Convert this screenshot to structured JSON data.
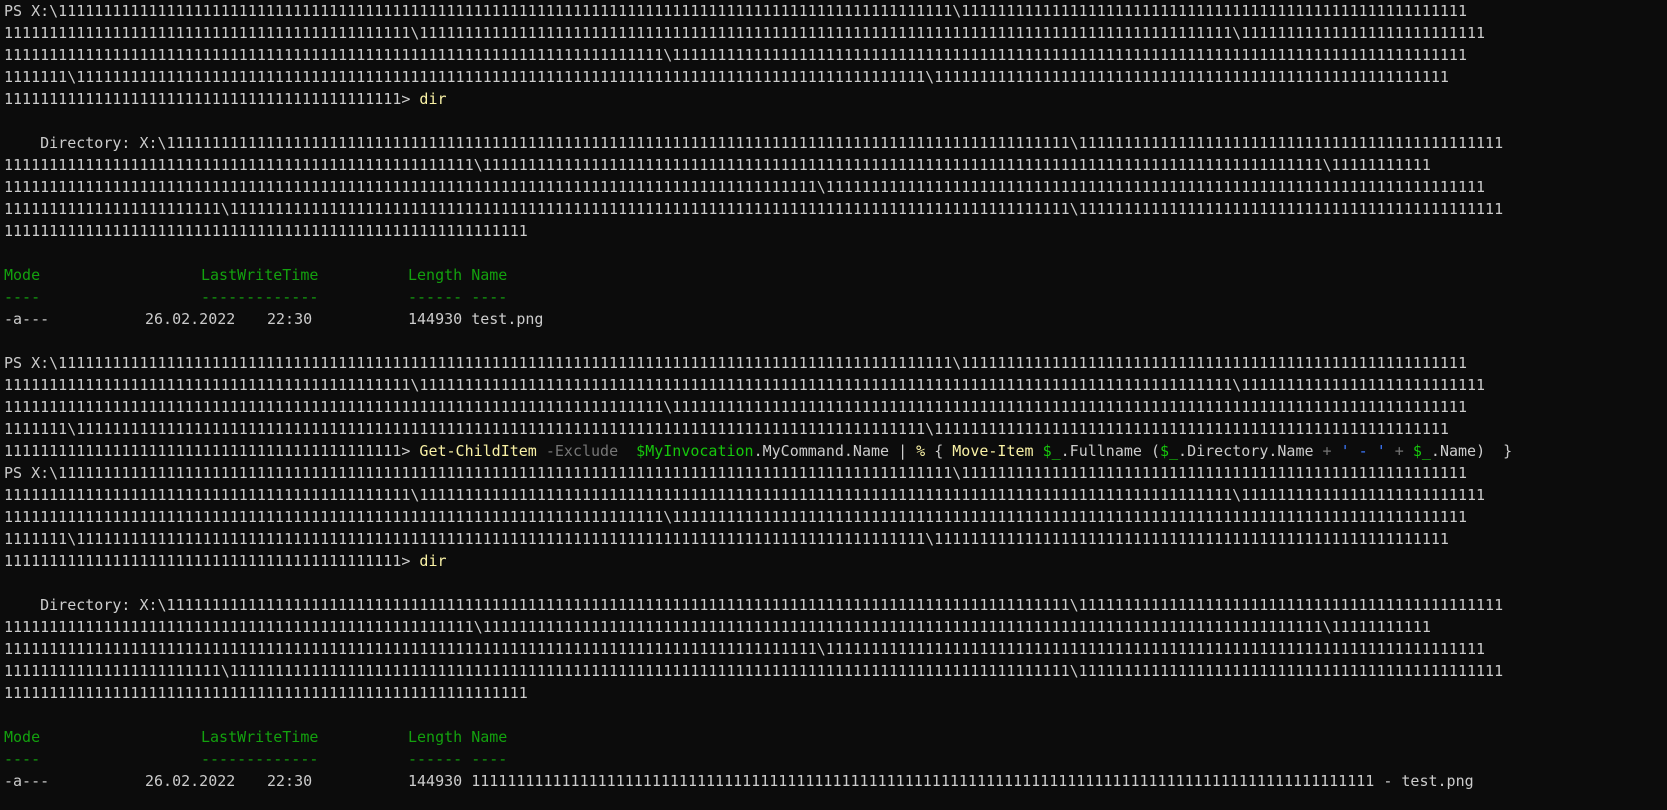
{
  "colors": {
    "background": "#0c0c0c",
    "foreground": "#cccccc",
    "command": "#f9f1a5",
    "parameter": "#767676",
    "variable": "#16c60c",
    "string": "#3b78ff",
    "header": "#13a10e"
  },
  "blocks": {
    "prompt1": {
      "lines": [
        "PS X:\\111111111111111111111111111111111111111111111111111111111111111111111111111111111111111111111111111\\11111111111111111111111111111111111111111111111111111111",
        "111111111111111111111111111111111111111111111\\111111111111111111111111111111111111111111111111111111111111111111111111111111111111111111\\111111111111111111111111111",
        "1111111111111111111111111111111111111111111111111111111111111111111111111\\1111111111111111111111111111111111111111111111111111111111111111111111111111111111111111",
        "1111111\\1111111111111111111111111111111111111111111111111111111111111111111111111111111111111111111111\\111111111111111111111111111111111111111111111111111111111"
      ],
      "last_path": "11111111111111111111111111111111111111111111>",
      "command": "dir"
    },
    "listing1": {
      "directory_lines": [
        "    Directory: X:\\1111111111111111111111111111111111111111111111111111111111111111111111111111111111111111111111111111\\11111111111111111111111111111111111111111111111",
        "1111111111111111111111111111111111111111111111111111\\111111111111111111111111111111111111111111111111111111111111111111111111111111111111111111111\\11111111111",
        "111111111111111111111111111111111111111111111111111111111111111111111111111111111111111111\\1111111111111111111111111111111111111111111111111111111111111111111111111",
        "111111111111111111111111\\111111111111111111111111111111111111111111111111111111111111111111111111111111111111111111111\\11111111111111111111111111111111111111111111111",
        "1111111111111111111111111111111111111111111111111111111111"
      ],
      "headers": {
        "mode": "Mode",
        "lastwrite": "LastWriteTime",
        "length": "Length",
        "name": "Name"
      },
      "separators": {
        "mode": "----",
        "lastwrite": "-------------",
        "length": "------",
        "name": "----"
      },
      "row": {
        "mode": "-a---",
        "date": "26.02.2022",
        "time": "22:30",
        "length": "144930",
        "name": "test.png"
      }
    },
    "prompt2": {
      "lines": [
        "PS X:\\111111111111111111111111111111111111111111111111111111111111111111111111111111111111111111111111111\\11111111111111111111111111111111111111111111111111111111",
        "111111111111111111111111111111111111111111111\\111111111111111111111111111111111111111111111111111111111111111111111111111111111111111111\\111111111111111111111111111",
        "1111111111111111111111111111111111111111111111111111111111111111111111111\\1111111111111111111111111111111111111111111111111111111111111111111111111111111111111111",
        "1111111\\1111111111111111111111111111111111111111111111111111111111111111111111111111111111111111111111\\111111111111111111111111111111111111111111111111111111111"
      ],
      "last_path": "11111111111111111111111111111111111111111111>",
      "cmd_tokens": {
        "t1": "Get-ChildItem",
        "t2": "-Exclude",
        "t3": "$MyInvocation",
        "t4": ".MyCommand.Name | ",
        "t5": "%",
        "t6": " { ",
        "t7": "Move-Item",
        "t8": "$_",
        "t9": ".Fullname (",
        "t10": "$_",
        "t11": ".Directory.Name ",
        "t12": "+",
        "t13": "' - '",
        "t14": "+",
        "t15": "$_",
        "t16": ".Name)  }"
      }
    },
    "prompt3": {
      "lines": [
        "PS X:\\111111111111111111111111111111111111111111111111111111111111111111111111111111111111111111111111111\\11111111111111111111111111111111111111111111111111111111",
        "111111111111111111111111111111111111111111111\\111111111111111111111111111111111111111111111111111111111111111111111111111111111111111111\\111111111111111111111111111",
        "1111111111111111111111111111111111111111111111111111111111111111111111111\\1111111111111111111111111111111111111111111111111111111111111111111111111111111111111111",
        "1111111\\1111111111111111111111111111111111111111111111111111111111111111111111111111111111111111111111\\111111111111111111111111111111111111111111111111111111111"
      ],
      "last_path": "11111111111111111111111111111111111111111111>",
      "command": "dir"
    },
    "listing2": {
      "directory_lines": [
        "    Directory: X:\\1111111111111111111111111111111111111111111111111111111111111111111111111111111111111111111111111111\\11111111111111111111111111111111111111111111111",
        "1111111111111111111111111111111111111111111111111111\\111111111111111111111111111111111111111111111111111111111111111111111111111111111111111111111\\11111111111",
        "111111111111111111111111111111111111111111111111111111111111111111111111111111111111111111\\1111111111111111111111111111111111111111111111111111111111111111111111111",
        "111111111111111111111111\\111111111111111111111111111111111111111111111111111111111111111111111111111111111111111111111\\11111111111111111111111111111111111111111111111",
        "1111111111111111111111111111111111111111111111111111111111"
      ],
      "headers": {
        "mode": "Mode",
        "lastwrite": "LastWriteTime",
        "length": "Length",
        "name": "Name"
      },
      "separators": {
        "mode": "----",
        "lastwrite": "-------------",
        "length": "------",
        "name": "----"
      },
      "row": {
        "mode": "-a---",
        "date": "26.02.2022",
        "time": "22:30",
        "length": "144930",
        "name": "1111111111111111111111111111111111111111111111111111111111111111111111111111111111111111111111111111 - test.png"
      }
    }
  }
}
